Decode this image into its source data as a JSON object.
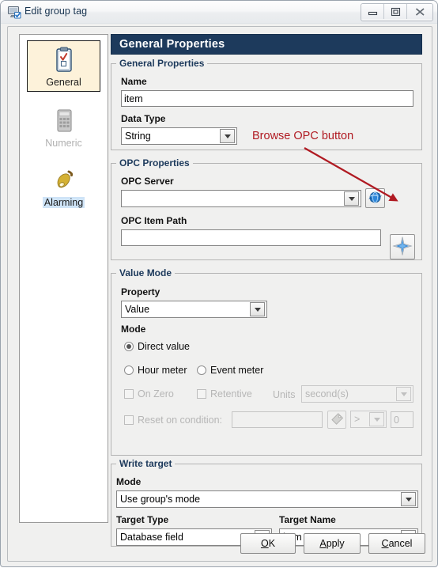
{
  "window": {
    "title": "Edit group tag",
    "icon": "monitor-check-icon",
    "buttons": {
      "minimize": "minimize-icon",
      "maximize": "maximize-icon",
      "close": "close-icon"
    }
  },
  "sidebar": {
    "items": [
      {
        "label": "General",
        "icon": "clipboard-icon",
        "selected": true,
        "disabled": false
      },
      {
        "label": "Numeric",
        "icon": "calculator-icon",
        "selected": false,
        "disabled": true
      },
      {
        "label": "Alarming",
        "icon": "bell-icon",
        "selected": false,
        "disabled": false
      }
    ]
  },
  "page": {
    "header": "General Properties"
  },
  "general_properties": {
    "legend": "General Properties",
    "name_label": "Name",
    "name_value": "item",
    "data_type_label": "Data Type",
    "data_type_value": "String"
  },
  "opc_properties": {
    "legend": "OPC Properties",
    "server_label": "OPC Server",
    "server_value": "",
    "item_path_label": "OPC Item Path",
    "item_path_value": "",
    "refresh_icon": "globe-refresh-icon",
    "browse_icon": "blue-star-icon"
  },
  "value_mode": {
    "legend": "Value Mode",
    "property_label": "Property",
    "property_value": "Value",
    "mode_label": "Mode",
    "radios": [
      {
        "label": "Direct value",
        "checked": true
      },
      {
        "label": "Hour meter",
        "checked": false
      },
      {
        "label": "Event meter",
        "checked": false
      }
    ],
    "on_zero_label": "On Zero",
    "on_zero_checked": false,
    "retentive_label": "Retentive",
    "retentive_checked": false,
    "units_label": "Units",
    "units_value": "second(s)",
    "reset_label": "Reset on condition:",
    "reset_checked": false,
    "reset_value": "",
    "tag_icon": "tag-icon",
    "operator_value": ">",
    "threshold_value": "0"
  },
  "write_target": {
    "legend": "Write target",
    "mode_label": "Mode",
    "mode_value": "Use group's mode",
    "target_type_label": "Target Type",
    "target_type_value": "Database field",
    "target_name_label": "Target Name",
    "target_name_value": "item"
  },
  "annotation": {
    "text": "Browse OPC button",
    "color": "#b01a22"
  },
  "footer": {
    "ok_pre": "",
    "ok_key": "O",
    "ok_post": "K",
    "apply_pre": "",
    "apply_key": "A",
    "apply_post": "pply",
    "cancel_pre": "",
    "cancel_key": "C",
    "cancel_post": "ancel"
  },
  "colors": {
    "header_bg": "#1d3a5c",
    "legend_text": "#1d3a5c",
    "selected_tab_bg": "#fdf2da",
    "annotation_red": "#b01a22",
    "dialog_bg": "#f0f0ef"
  }
}
